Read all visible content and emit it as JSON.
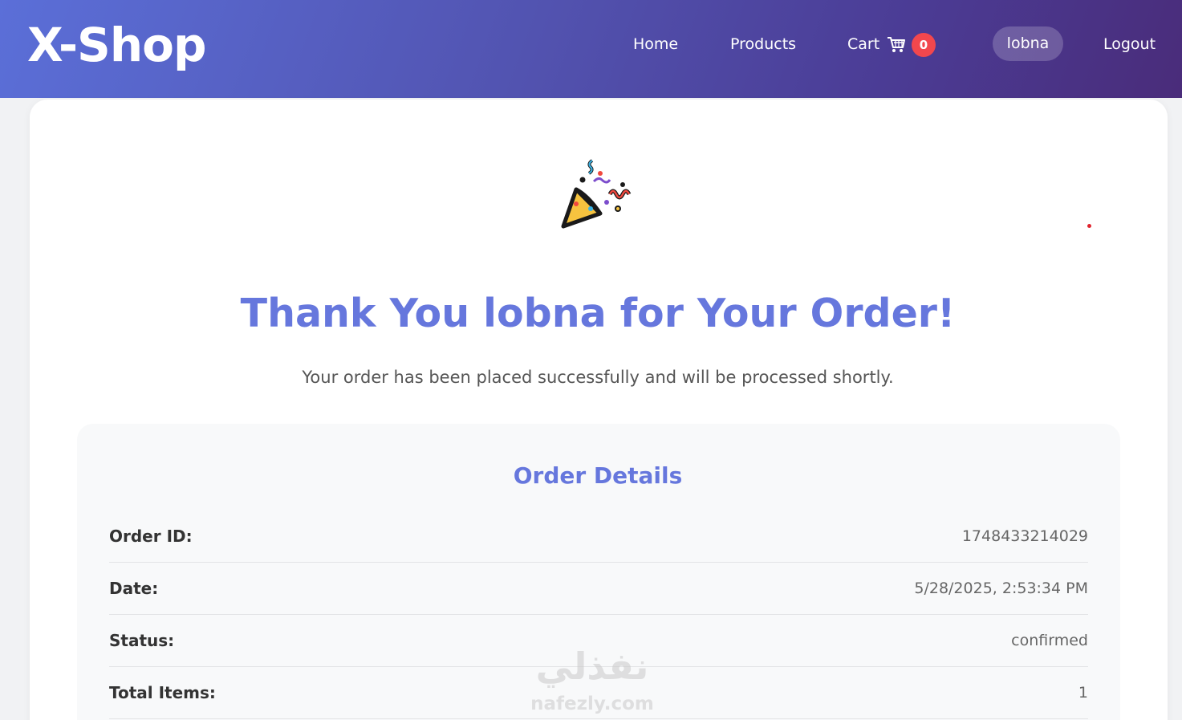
{
  "header": {
    "logo": "X-Shop",
    "nav": {
      "home": "Home",
      "products": "Products",
      "cart": "Cart",
      "cart_count": "0",
      "user": "lobna",
      "logout": "Logout"
    },
    "gradient": [
      "#5b6fd8",
      "#4a2c7a"
    ]
  },
  "icons": {
    "cart": "shopping-cart-icon",
    "celebration": "party-popper-icon"
  },
  "confirmation": {
    "title": "Thank You lobna for Your Order!",
    "subtitle": "Your order has been placed successfully and will be processed shortly."
  },
  "order_details": {
    "title": "Order Details",
    "rows": [
      {
        "label": "Order ID:",
        "value": "1748433214029"
      },
      {
        "label": "Date:",
        "value": "5/28/2025, 2:53:34 PM"
      },
      {
        "label": "Status:",
        "value": "confirmed"
      },
      {
        "label": "Total Items:",
        "value": "1"
      }
    ]
  },
  "watermark": {
    "arabic": "نفذلي",
    "latin": "nafezly.com"
  },
  "colors": {
    "accent": "#6677dd",
    "badge": "#f2474d"
  }
}
